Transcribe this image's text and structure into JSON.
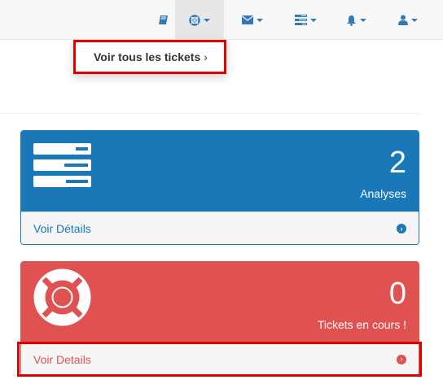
{
  "navbar": {
    "items": [
      {
        "icon": "book-icon",
        "has_caret": false
      },
      {
        "icon": "life-ring-icon",
        "has_caret": true,
        "active": true
      },
      {
        "icon": "envelope-icon",
        "has_caret": true
      },
      {
        "icon": "tasks-icon",
        "has_caret": true
      },
      {
        "icon": "bell-icon",
        "has_caret": true
      },
      {
        "icon": "user-icon",
        "has_caret": true
      }
    ]
  },
  "dropdown": {
    "label": "Voir tous les tickets",
    "chevron": "›"
  },
  "panels": {
    "analyses": {
      "count": "2",
      "label": "Analyses",
      "footer": "Voir Détails",
      "icon": "server-icon",
      "color": "#1a78b8"
    },
    "tickets": {
      "count": "0",
      "label": "Tickets en cours !",
      "footer": "Voir Details",
      "icon": "life-ring-icon",
      "color": "#e05252"
    }
  },
  "colors": {
    "link": "#337ab7",
    "highlight": "#e00000"
  }
}
